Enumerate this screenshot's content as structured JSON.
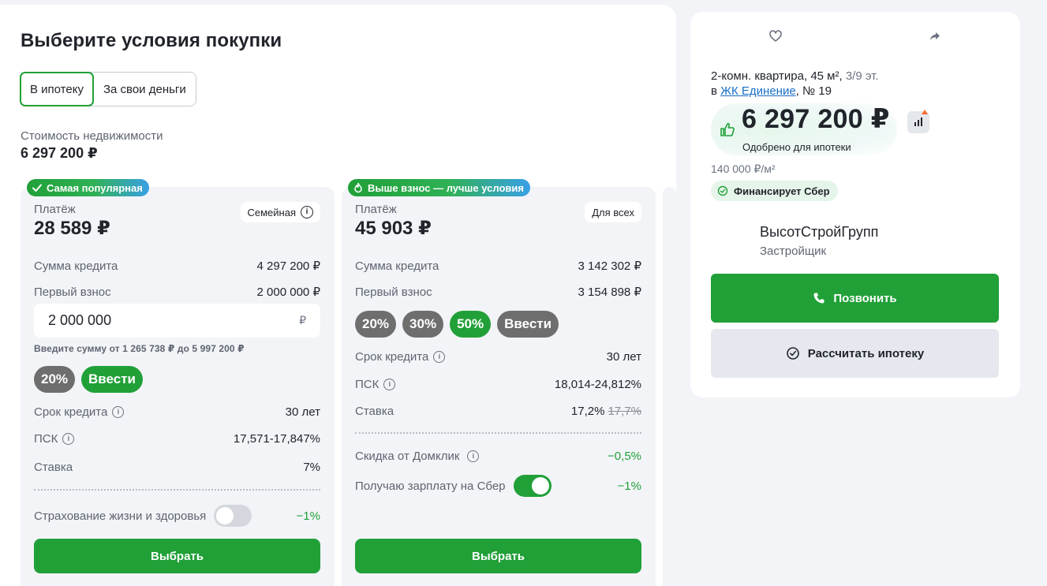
{
  "page": {
    "title": "Выберите условия покупки",
    "toggles": [
      "В ипотеку",
      "За свои деньги"
    ],
    "cost_label": "Стоимость недвижимости",
    "cost_value": "6 297 200 ₽"
  },
  "card1": {
    "ribbon": "Самая популярная",
    "pay_label": "Платёж",
    "pay_value": "28 589 ₽",
    "tag": "Семейная",
    "loan_label": "Сумма кредита",
    "loan_value": "4 297 200 ₽",
    "down_label": "Первый взнос",
    "down_value": "2 000 000 ₽",
    "input_value": "2 000 000",
    "input_currency": "₽",
    "hint": "Введите сумму от 1 265 738 ₽ до 5 997 200 ₽",
    "chips": [
      "20%",
      "Ввести"
    ],
    "term_label": "Срок кредита",
    "term_value": "30 лет",
    "psk_label": "ПСК",
    "psk_value": "17,571-17,847%",
    "rate_label": "Ставка",
    "rate_value": "7%",
    "insurance_label": "Страхование жизни и здоровья",
    "insurance_value": "−1%",
    "button": "Выбрать"
  },
  "card2": {
    "ribbon": "Выше взнос — лучше условия",
    "pay_label": "Платёж",
    "pay_value": "45 903 ₽",
    "tag": "Для всех",
    "loan_label": "Сумма кредита",
    "loan_value": "3 142 302 ₽",
    "down_label": "Первый взнос",
    "down_value": "3 154 898 ₽",
    "chips": [
      "20%",
      "30%",
      "50%",
      "Ввести"
    ],
    "term_label": "Срок кредита",
    "term_value": "30 лет",
    "psk_label": "ПСК",
    "psk_value": "18,014-24,812%",
    "rate_label": "Ставка",
    "rate_value": "17,2%",
    "rate_old": "17,7%",
    "discount_label": "Скидка от Домклик",
    "discount_value": "−0,5%",
    "salary_label": "Получаю зарплату на Сбер",
    "salary_value": "−1%",
    "button": "Выбрать"
  },
  "sidebar": {
    "desc_prefix": "2-комн. квартира, 45 м²,",
    "floor": "3/9 эт.",
    "in": "в",
    "complex": "ЖК Единение",
    "number": ", № 19",
    "price": "6 297 200 ₽",
    "approved": "Одобрено для ипотеки",
    "price_per_m": "140 000 ₽/м²",
    "financed": "Финансирует Сбер",
    "developer_name": "ВысотСтройГрупп",
    "developer_role": "Застройщик",
    "call_button": "Позвонить",
    "calc_button": "Рассчитать ипотеку"
  },
  "colors": {
    "accent": "#21a038",
    "link": "#1a6fc7",
    "chip_gray": "#6e6e6e"
  },
  "icons": [
    "heart-icon",
    "share-icon",
    "thumb-up-icon",
    "chart-icon",
    "check-icon",
    "fire-icon",
    "info-icon",
    "phone-icon",
    "check-circle-icon"
  ]
}
